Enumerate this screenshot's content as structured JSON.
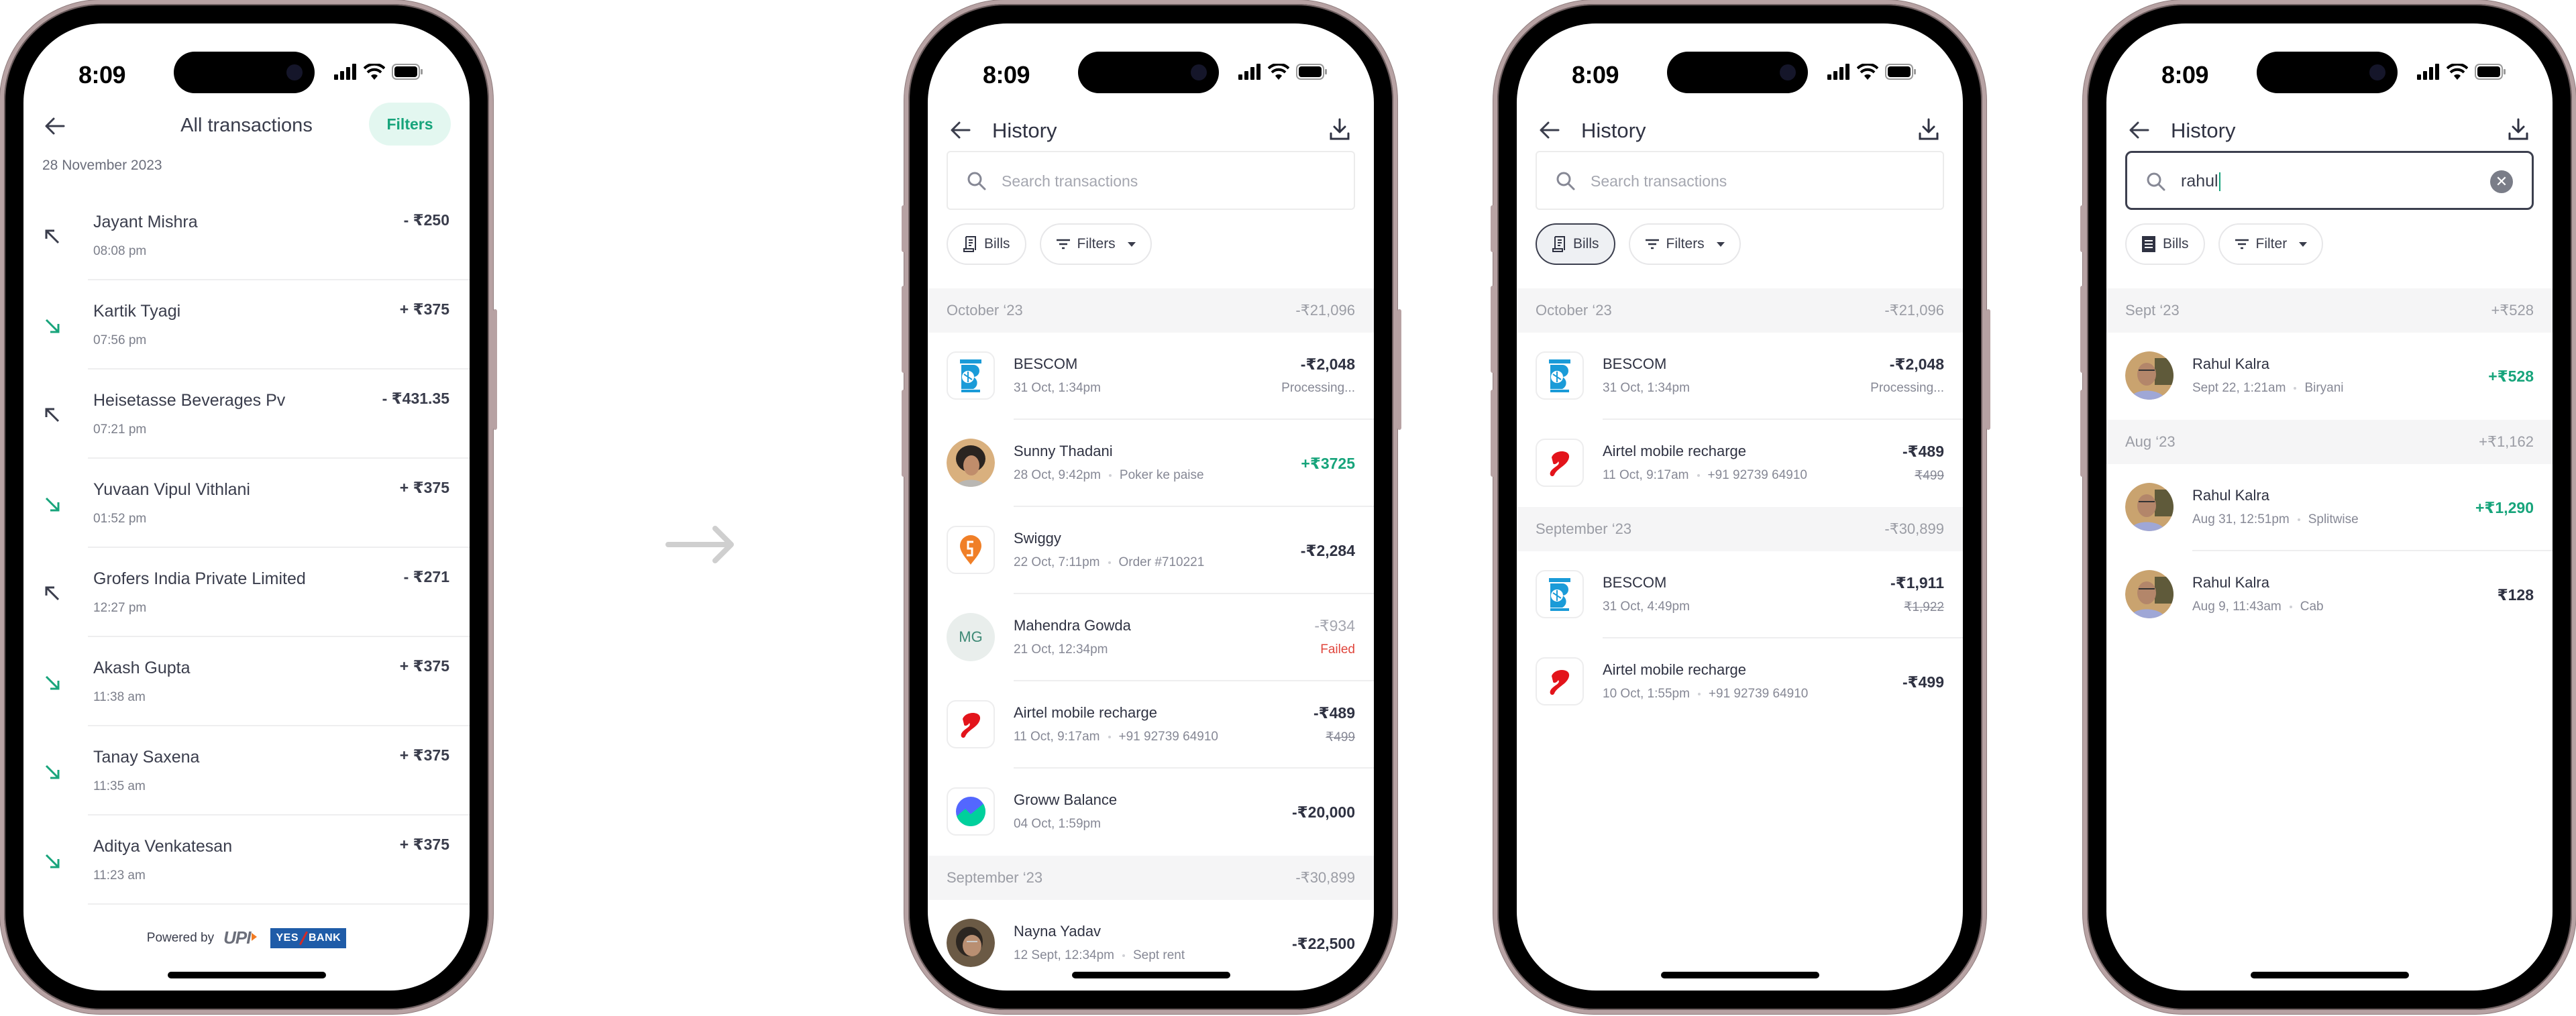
{
  "status_bar": {
    "time": "8:09"
  },
  "flow_arrow": {
    "icon": "arrow-right-icon"
  },
  "screen1": {
    "title": "All transactions",
    "filters_label": "Filters",
    "date_header": "28 November 2023",
    "transactions": [
      {
        "name": "Jayant Mishra",
        "time": "08:08 pm",
        "amount": "- ₹250",
        "direction": "sent"
      },
      {
        "name": "Kartik Tyagi",
        "time": "07:56 pm",
        "amount": "+ ₹375",
        "direction": "received"
      },
      {
        "name": "Heisetasse Beverages Pv",
        "time": "07:21 pm",
        "amount": "- ₹431.35",
        "direction": "sent"
      },
      {
        "name": "Yuvaan Vipul Vithlani",
        "time": "01:52 pm",
        "amount": "+ ₹375",
        "direction": "received"
      },
      {
        "name": "Grofers India Private Limited",
        "time": "12:27 pm",
        "amount": "- ₹271",
        "direction": "sent"
      },
      {
        "name": "Akash Gupta",
        "time": "11:38 am",
        "amount": "+ ₹375",
        "direction": "received"
      },
      {
        "name": "Tanay Saxena",
        "time": "11:35 am",
        "amount": "+ ₹375",
        "direction": "received"
      },
      {
        "name": "Aditya Venkatesan",
        "time": "11:23 am",
        "amount": "+ ₹375",
        "direction": "received"
      }
    ],
    "footer": {
      "powered_by": "Powered by",
      "upi_logo": "UPI",
      "bank_logo_left": "YES",
      "bank_logo_right": "BANK"
    }
  },
  "screen2": {
    "title": "History",
    "search_placeholder": "Search transactions",
    "chips": {
      "bills": "Bills",
      "filters": "Filters"
    },
    "groups": [
      {
        "month": "October ‘23",
        "total": "-₹21,096",
        "items": [
          {
            "icon": "bescom-logo",
            "name": "BESCOM",
            "sub": "31 Oct, 1:34pm",
            "note": "",
            "amount": "-₹2,048",
            "status": "Processing..."
          },
          {
            "icon": "avatar-sunny",
            "name": "Sunny Thadani",
            "sub": "28 Oct, 9:42pm",
            "note": "Poker ke paise",
            "amount": "+₹3725",
            "status": ""
          },
          {
            "icon": "swiggy-logo",
            "name": "Swiggy",
            "sub": "22 Oct, 7:11pm",
            "note": "Order #710221",
            "amount": "-₹2,284",
            "status": ""
          },
          {
            "icon": "initials",
            "initials": "MG",
            "name": "Mahendra Gowda",
            "sub": "21 Oct, 12:34pm",
            "note": "",
            "amount": "-₹934",
            "status": "Failed"
          },
          {
            "icon": "airtel-logo",
            "name": "Airtel mobile recharge",
            "sub": "11 Oct, 9:17am",
            "note": "+91 92739 64910",
            "amount": "-₹489",
            "original": "₹499"
          },
          {
            "icon": "groww-logo",
            "name": "Groww Balance",
            "sub": "04 Oct, 1:59pm",
            "note": "",
            "amount": "-₹20,000",
            "status": ""
          }
        ]
      },
      {
        "month": "September ‘23",
        "total": "-₹30,899",
        "items": [
          {
            "icon": "avatar-nayna",
            "name": "Nayna Yadav",
            "sub": "12 Sept, 12:34pm",
            "note": "Sept rent",
            "amount": "-₹22,500",
            "status": ""
          }
        ]
      }
    ]
  },
  "screen3": {
    "title": "History",
    "search_placeholder": "Search transactions",
    "chips": {
      "bills": "Bills",
      "filters": "Filters",
      "bills_active": true
    },
    "groups": [
      {
        "month": "October ‘23",
        "total": "-₹21,096",
        "items": [
          {
            "icon": "bescom-logo",
            "name": "BESCOM",
            "sub": "31 Oct, 1:34pm",
            "note": "",
            "amount": "-₹2,048",
            "status": "Processing..."
          },
          {
            "icon": "airtel-logo",
            "name": "Airtel mobile recharge",
            "sub": "11 Oct, 9:17am",
            "note": "+91 92739 64910",
            "amount": "-₹489",
            "original": "₹499"
          }
        ]
      },
      {
        "month": "September ‘23",
        "total": "-₹30,899",
        "items": [
          {
            "icon": "bescom-logo",
            "name": "BESCOM",
            "sub": "31 Oct, 4:49pm",
            "note": "",
            "amount": "-₹1,911",
            "original": "₹1,922"
          },
          {
            "icon": "airtel-logo",
            "name": "Airtel mobile recharge",
            "sub": "10 Oct, 1:55pm",
            "note": "+91 92739 64910",
            "amount": "-₹499"
          }
        ]
      }
    ]
  },
  "screen4": {
    "title": "History",
    "search_value": "rahul",
    "chips": {
      "bills": "Bills",
      "filters": "Filter"
    },
    "groups": [
      {
        "month": "Sept ‘23",
        "total": "+₹528",
        "items": [
          {
            "icon": "avatar-rahul",
            "name": "Rahul Kalra",
            "sub": "Sept 22, 1:21am",
            "note": "Biryani",
            "amount": "+₹528"
          }
        ]
      },
      {
        "month": "Aug ‘23",
        "total": "+₹1,162",
        "items": [
          {
            "icon": "avatar-rahul",
            "name": "Rahul Kalra",
            "sub": "Aug 31, 12:51pm",
            "note": "Splitwise",
            "amount": "+₹1,290"
          },
          {
            "icon": "avatar-rahul",
            "name": "Rahul Kalra",
            "sub": "Aug 9, 11:43am",
            "note": "Cab",
            "amount": "₹128"
          }
        ]
      }
    ]
  },
  "colors": {
    "credit_green": "#17a47b",
    "failed_red": "#e0463d",
    "filters_pill_bg": "#e3f7f0",
    "text_dark": "#2f3242",
    "frame": "#b7a2a3"
  }
}
